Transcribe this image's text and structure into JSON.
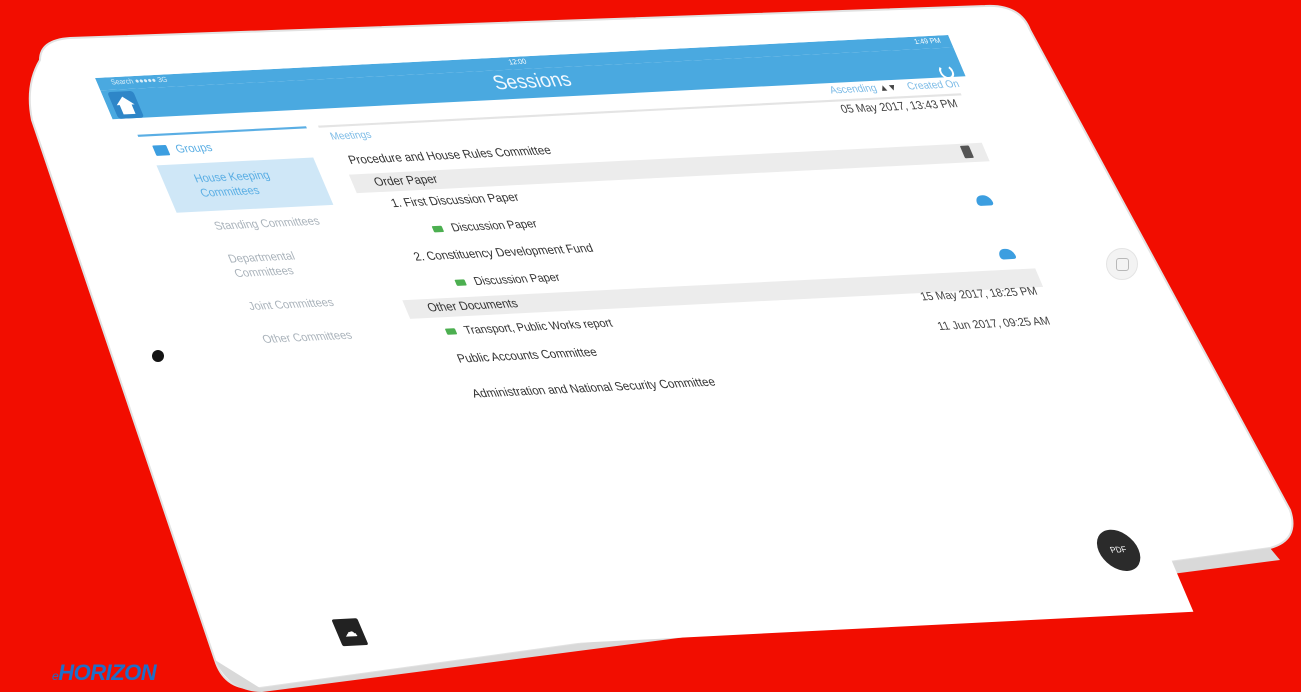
{
  "status": {
    "carrier": "Search ●●●●● 3G",
    "time": "12:00",
    "battery": "1:49 PM"
  },
  "nav": {
    "title": "Sessions",
    "home_icon": "home-icon",
    "refresh_icon": "refresh-icon"
  },
  "sort": {
    "ascending": "Ascending",
    "arrows": "▲▼",
    "created_on": "Created On"
  },
  "sidebar": {
    "header": "Groups",
    "items": [
      {
        "label": "House Keeping Committees",
        "active": true
      },
      {
        "label": "Standing Committees",
        "active": false
      },
      {
        "label": "Departmental Committees",
        "active": false
      },
      {
        "label": "Joint Committees",
        "active": false
      },
      {
        "label": "Other Committees",
        "active": false
      }
    ]
  },
  "main": {
    "header_label": "Meetings",
    "meetings": [
      {
        "title": "Procedure and House Rules Committee",
        "date": "05 May 2017,  13:43 PM",
        "order_paper_label": "Order Paper",
        "items": [
          {
            "label": "1.  First Discussion Paper",
            "doc": "Discussion Paper"
          },
          {
            "label": "2.  Constituency Development Fund",
            "doc": "Discussion Paper"
          }
        ],
        "other_docs_label": "Other Documents",
        "other_docs": [
          {
            "doc": "Transport, Public Works report"
          }
        ]
      },
      {
        "title": "Public Accounts Committee",
        "date": "15 May 2017,  18:25 PM"
      },
      {
        "title": "Administration and National Security Committee",
        "date": "11 Jun 2017,  09:25 AM"
      }
    ]
  },
  "buttons": {
    "pdf": "PDF",
    "upload_icon": "cloud-upload-icon"
  },
  "logo": {
    "prefix": "e",
    "text": "HORIZON"
  },
  "colors": {
    "background": "#f20d00",
    "accent": "#4aa9e0",
    "active_bg": "#cfe7f7",
    "doc_icon": "#4caf50"
  }
}
